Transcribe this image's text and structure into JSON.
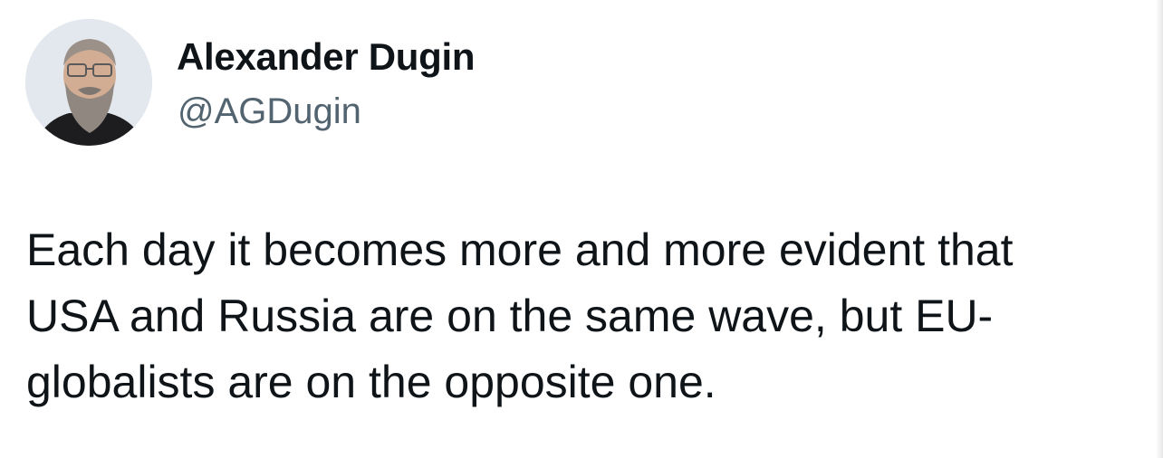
{
  "tweet": {
    "author": {
      "display_name": "Alexander Dugin",
      "handle": "@AGDugin"
    },
    "text_lines": [
      "Each day it becomes more and more evident that",
      "USA and Russia are on the same wave, but EU-",
      "globalists are on the opposite one."
    ]
  },
  "colors": {
    "primary_text": "#0f1419",
    "secondary_text": "#536471",
    "background": "#ffffff"
  }
}
